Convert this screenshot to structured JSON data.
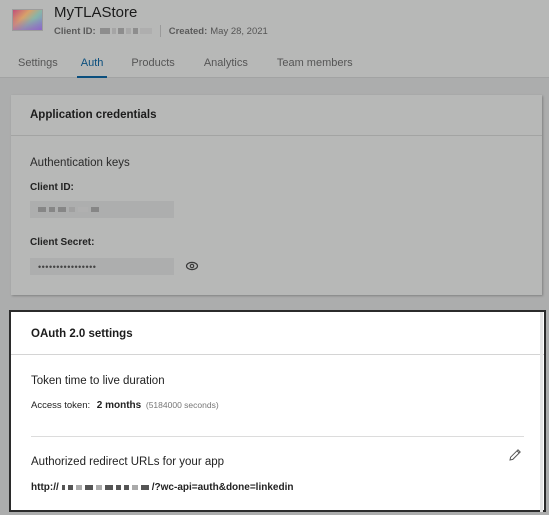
{
  "app": {
    "title": "MyTLAStore",
    "client_id_label": "Client ID:",
    "created_label": "Created:",
    "created_value": "May 28, 2021"
  },
  "tabs": [
    {
      "label": "Settings",
      "active": false
    },
    {
      "label": "Auth",
      "active": true
    },
    {
      "label": "Products",
      "active": false
    },
    {
      "label": "Analytics",
      "active": false
    },
    {
      "label": "Team members",
      "active": false
    }
  ],
  "credentials": {
    "title": "Application credentials",
    "section": "Authentication keys",
    "client_id_label": "Client ID:",
    "client_secret_label": "Client Secret:",
    "client_secret_value": "••••••••••••••••",
    "reveal_icon": "eye-icon"
  },
  "oauth": {
    "title": "OAuth 2.0 settings",
    "token_section": "Token time to live duration",
    "access_token_label": "Access token:",
    "access_token_value": "2 months",
    "access_token_seconds": "(5184000 seconds)",
    "redirect_section": "Authorized redirect URLs for your app",
    "redirect_prefix": "http://",
    "redirect_suffix": "/?wc-api=auth&done=linkedin",
    "edit_icon": "pencil-icon"
  }
}
